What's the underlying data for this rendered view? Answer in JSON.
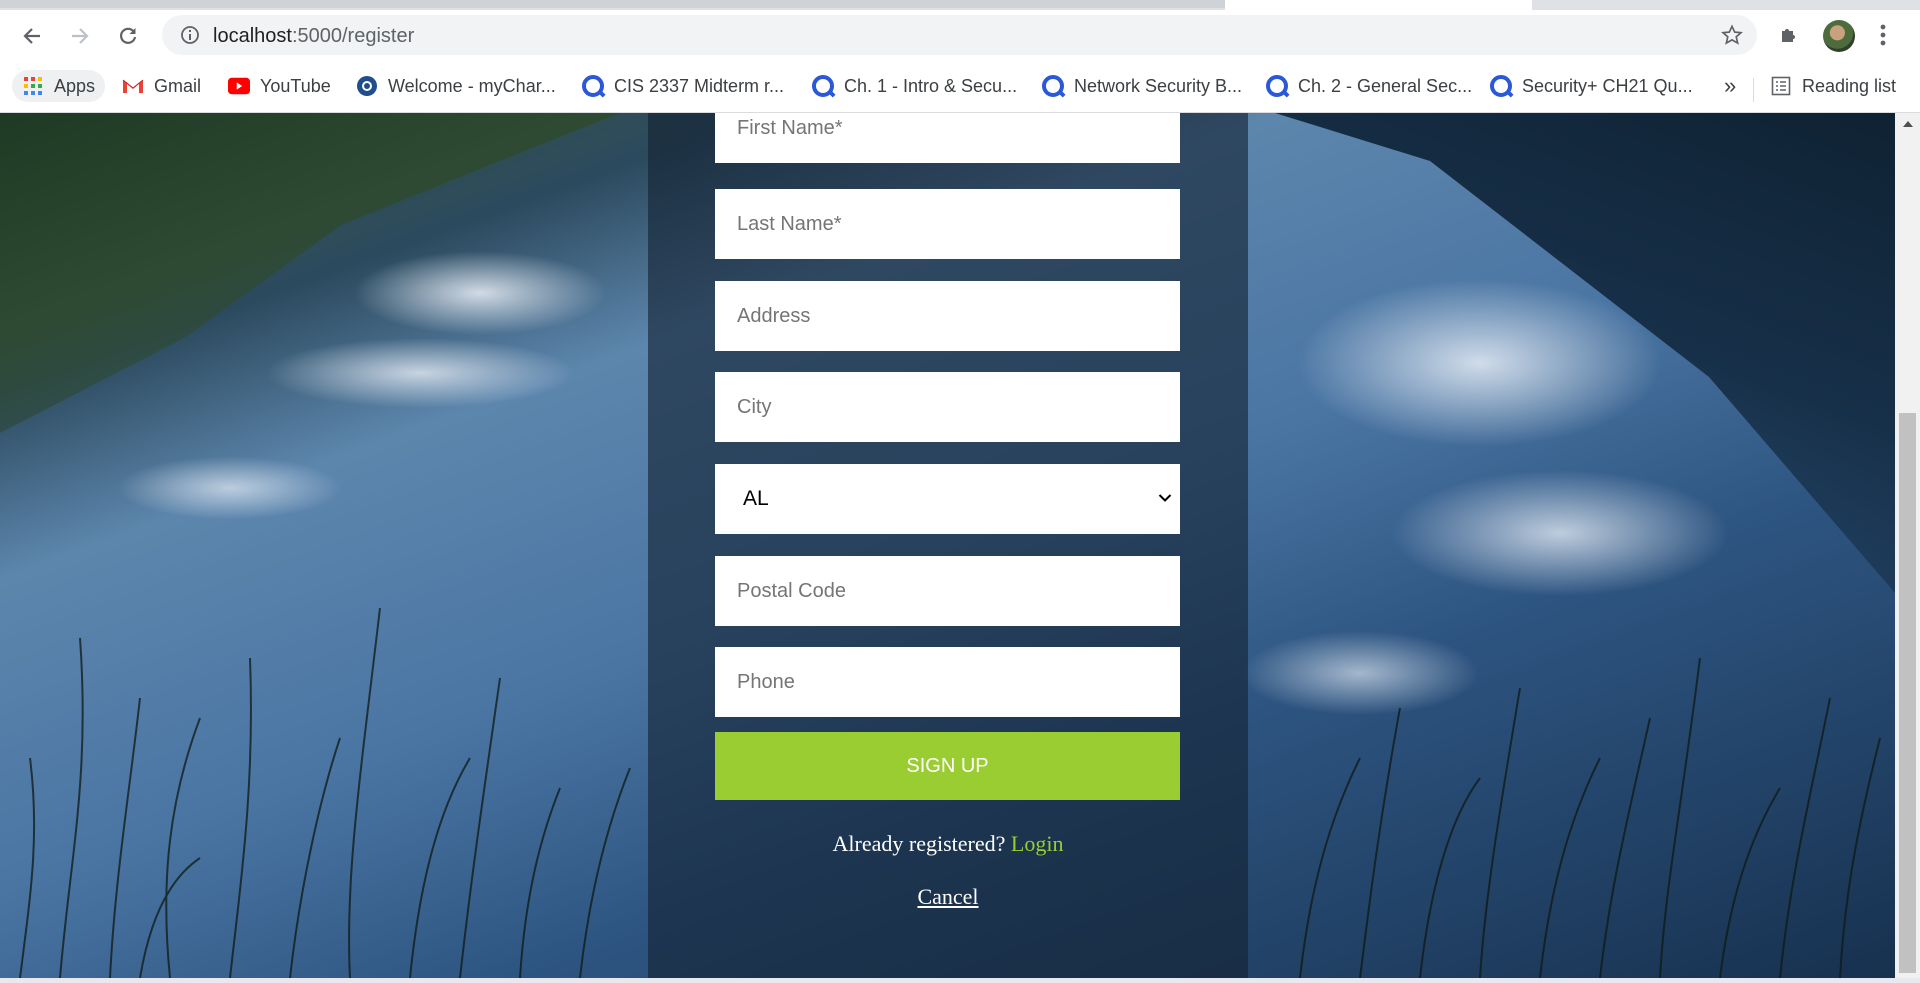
{
  "browser": {
    "url_host": "localhost",
    "url_path": ":5000/register",
    "bookmarks": [
      {
        "label": "Apps",
        "icon": "apps-grid-icon"
      },
      {
        "label": "Gmail",
        "icon": "gmail-icon"
      },
      {
        "label": "YouTube",
        "icon": "youtube-icon"
      },
      {
        "label": "Welcome - myChar...",
        "icon": "mychart-icon"
      },
      {
        "label": "CIS 2337 Midterm r...",
        "icon": "quizlet-icon"
      },
      {
        "label": "Ch. 1 - Intro & Secu...",
        "icon": "quizlet-icon"
      },
      {
        "label": "Network Security B...",
        "icon": "quizlet-icon"
      },
      {
        "label": "Ch. 2 - General Sec...",
        "icon": "quizlet-icon"
      },
      {
        "label": "Security+ CH21 Qu...",
        "icon": "quizlet-icon"
      }
    ],
    "overflow_label": "»",
    "reading_list_label": "Reading list"
  },
  "form": {
    "first_name_placeholder": "First Name*",
    "last_name_placeholder": "Last Name*",
    "address_placeholder": "Address",
    "city_placeholder": "City",
    "state_selected": "AL",
    "postal_code_placeholder": "Postal Code",
    "phone_placeholder": "Phone",
    "signup_label": "SIGN UP",
    "already_text": "Already registered?",
    "login_label": "Login",
    "cancel_label": "Cancel"
  },
  "colors": {
    "accent_green": "#9acd32",
    "panel_overlay": "rgba(20,34,50,0.62)"
  }
}
